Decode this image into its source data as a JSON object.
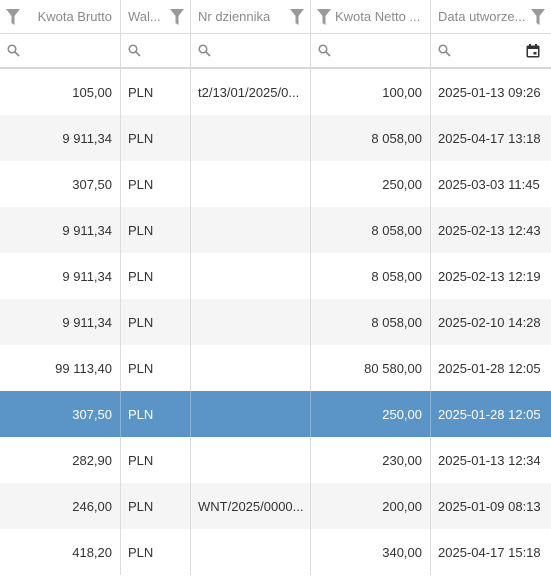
{
  "columns": [
    {
      "key": "brutto",
      "label": "Kwota Brutto",
      "align": "right"
    },
    {
      "key": "waluta",
      "label": "Wal...",
      "align": "left"
    },
    {
      "key": "nr",
      "label": "Nr dziennika",
      "align": "left"
    },
    {
      "key": "netto",
      "label": "Kwota Netto ...",
      "align": "right"
    },
    {
      "key": "data",
      "label": "Data utworze...",
      "align": "left"
    }
  ],
  "filter_placeholders": [
    "",
    "",
    "",
    "",
    ""
  ],
  "selected_row_index": 7,
  "rows": [
    {
      "brutto": "105,00",
      "waluta": "PLN",
      "nr": "t2/13/01/2025/0...",
      "netto": "100,00",
      "data": "2025-01-13 09:26"
    },
    {
      "brutto": "9 911,34",
      "waluta": "PLN",
      "nr": "",
      "netto": "8 058,00",
      "data": "2025-04-17 13:18"
    },
    {
      "brutto": "307,50",
      "waluta": "PLN",
      "nr": "",
      "netto": "250,00",
      "data": "2025-03-03 11:45"
    },
    {
      "brutto": "9 911,34",
      "waluta": "PLN",
      "nr": "",
      "netto": "8 058,00",
      "data": "2025-02-13 12:43"
    },
    {
      "brutto": "9 911,34",
      "waluta": "PLN",
      "nr": "",
      "netto": "8 058,00",
      "data": "2025-02-13 12:19"
    },
    {
      "brutto": "9 911,34",
      "waluta": "PLN",
      "nr": "",
      "netto": "8 058,00",
      "data": "2025-02-10 14:28"
    },
    {
      "brutto": "99 113,40",
      "waluta": "PLN",
      "nr": "",
      "netto": "80 580,00",
      "data": "2025-01-28 12:05"
    },
    {
      "brutto": "307,50",
      "waluta": "PLN",
      "nr": "",
      "netto": "250,00",
      "data": "2025-01-28 12:05"
    },
    {
      "brutto": "282,90",
      "waluta": "PLN",
      "nr": "",
      "netto": "230,00",
      "data": "2025-01-13 12:34"
    },
    {
      "brutto": "246,00",
      "waluta": "PLN",
      "nr": "WNT/2025/0000...",
      "netto": "200,00",
      "data": "2025-01-09 08:13"
    },
    {
      "brutto": "418,20",
      "waluta": "PLN",
      "nr": "",
      "netto": "340,00",
      "data": "2025-04-17 15:18"
    }
  ],
  "icons": {
    "column_filter": "funnel-icon",
    "search": "search-icon",
    "date_picker": "calendar-icon"
  },
  "colors": {
    "selected_row": "#5b95c8",
    "alt_row": "#f5f5f5",
    "header_text": "#8a8a8a",
    "grid_line": "#dcdcdc"
  }
}
